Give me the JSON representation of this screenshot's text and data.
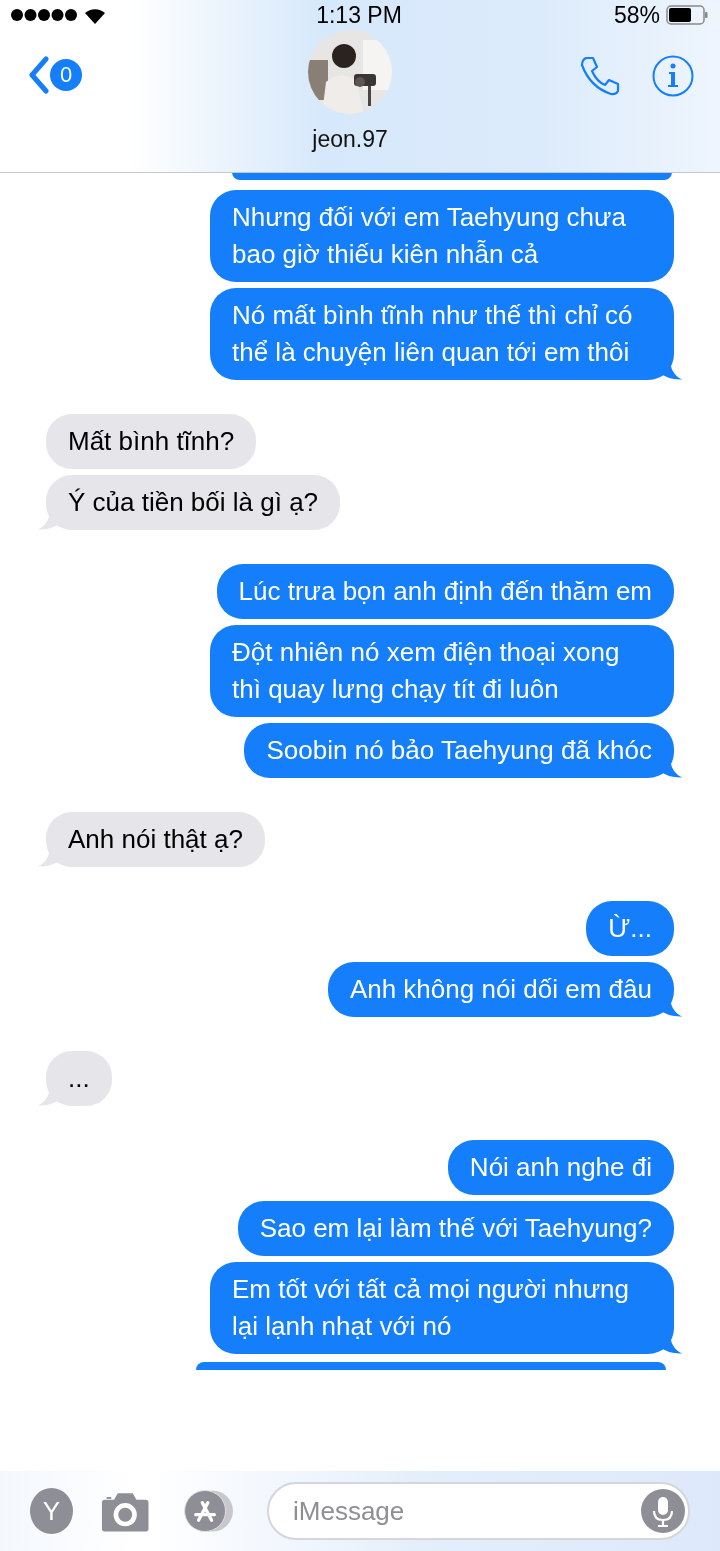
{
  "status_bar": {
    "time": "1:13 PM",
    "battery": "58%"
  },
  "header": {
    "back_badge": "0",
    "contact_name": "jeon.97"
  },
  "groups": [
    {
      "kind": "sent",
      "messages": [
        "Nhưng đối với em Taehyung chưa bao giờ thiếu kiên nhẫn cả",
        "Nó mất bình tĩnh như thế thì chỉ có thể là chuyện liên quan tới em thôi"
      ]
    },
    {
      "kind": "received",
      "messages": [
        "Mất bình tĩnh?",
        "Ý của tiền bối là gì ạ?"
      ]
    },
    {
      "kind": "sent",
      "messages": [
        "Lúc trưa bọn anh định đến thăm em",
        "Đột nhiên nó xem điện thoại xong thì quay lưng chạy tít đi luôn",
        "Soobin nó bảo Taehyung đã khóc"
      ]
    },
    {
      "kind": "received",
      "messages": [
        "Anh nói thật ạ?"
      ]
    },
    {
      "kind": "sent",
      "messages": [
        "Ừ...",
        "Anh không nói dối em đâu"
      ]
    },
    {
      "kind": "received",
      "messages": [
        "..."
      ]
    },
    {
      "kind": "sent",
      "messages": [
        "Nói anh nghe đi",
        "Sao em lại làm thế với Taehyung?",
        "Em tốt với tất cả mọi người nhưng lại lạnh nhạt với nó"
      ]
    }
  ],
  "input": {
    "app_letter": "Y",
    "placeholder": "iMessage"
  }
}
